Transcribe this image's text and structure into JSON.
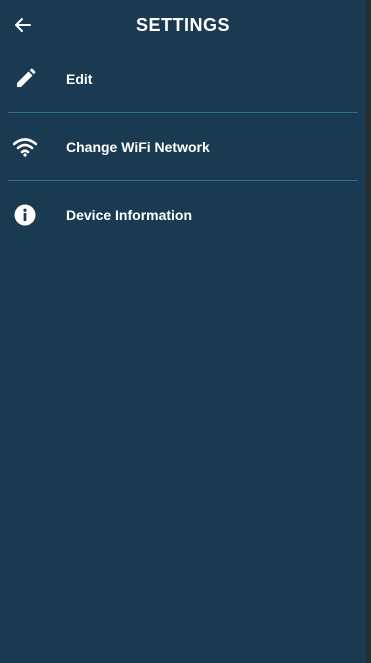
{
  "header": {
    "title": "SETTINGS",
    "back_icon": "arrow-left-icon"
  },
  "menu": {
    "items": [
      {
        "label": "Edit",
        "icon": "pencil-icon"
      },
      {
        "label": "Change WiFi Network",
        "icon": "wifi-icon"
      },
      {
        "label": "Device Information",
        "icon": "info-icon"
      }
    ]
  },
  "colors": {
    "background": "#1a3a52",
    "divider": "#2c6f8e",
    "text": "#ffffff"
  }
}
